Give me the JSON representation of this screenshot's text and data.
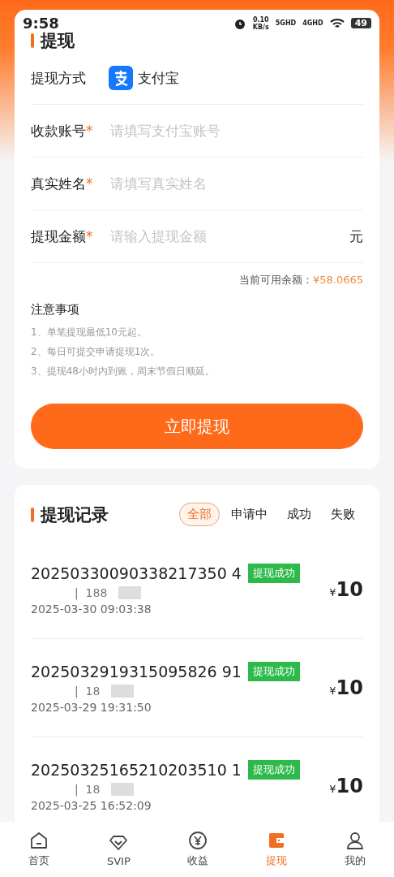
{
  "status_bar": {
    "time": "9:58",
    "speed": "0.10",
    "speed_unit": "KB/s",
    "sim1": "5GHD",
    "sim2": "4GHD",
    "battery": "49"
  },
  "withdraw": {
    "title": "提现",
    "method": {
      "label": "提现方式",
      "value": "支付宝"
    },
    "fields": [
      {
        "label": "收款账号",
        "required_mark": "*",
        "placeholder": "请填写支付宝账号"
      },
      {
        "label": "真实姓名",
        "required_mark": "*",
        "placeholder": "请填写真实姓名"
      },
      {
        "label": "提现金额",
        "required_mark": "*",
        "placeholder": "请输入提现金额",
        "unit": "元"
      }
    ],
    "balance_label": "当前可用余额：",
    "balance": "¥58.0665",
    "notes_title": "注意事项",
    "notes": [
      "1、单笔提现最低10元起。",
      "2、每日可提交申请提现1次。",
      "3、提现48小时内到账，周末节假日顺延。"
    ],
    "button": "立即提现"
  },
  "records": {
    "title": "提现记录",
    "tabs": [
      {
        "label": "全部",
        "selected": true
      },
      {
        "label": "申请中",
        "selected": false
      },
      {
        "label": "成功",
        "selected": false
      },
      {
        "label": "失败",
        "selected": false
      }
    ],
    "items": [
      {
        "order": "20250330090338217350 4",
        "status": "提现成功",
        "account": "|  188",
        "time": "2025-03-30 09:03:38",
        "currency": "¥",
        "amount": "10"
      },
      {
        "order": "2025032919315095826 91",
        "status": "提现成功",
        "account": "|  18",
        "time": "2025-03-29 19:31:50",
        "currency": "¥",
        "amount": "10"
      },
      {
        "order": "20250325165210203510 1",
        "status": "提现成功",
        "account": "|  18",
        "time": "2025-03-25 16:52:09",
        "currency": "¥",
        "amount": "10"
      }
    ]
  },
  "tab_bar": [
    {
      "kind": "home",
      "label": "首页",
      "selected": false
    },
    {
      "kind": "diamond",
      "label": "SVIP",
      "selected": false
    },
    {
      "kind": "yuan",
      "label": "收益",
      "selected": false
    },
    {
      "kind": "wallet",
      "label": "提现",
      "selected": true
    },
    {
      "kind": "user",
      "label": "我的",
      "selected": false
    }
  ]
}
